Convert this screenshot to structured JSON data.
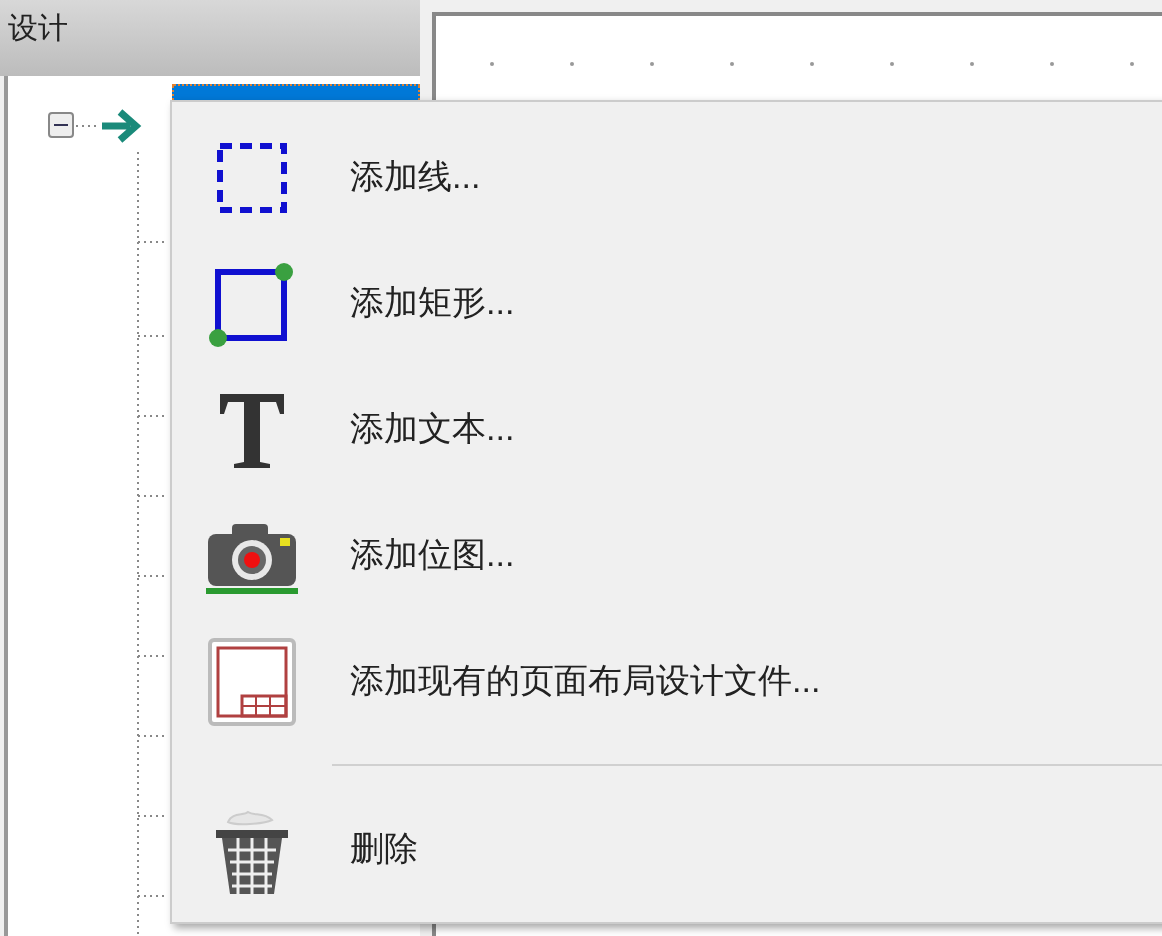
{
  "panel": {
    "title": "设计"
  },
  "tree": {
    "expanded": true
  },
  "menu": {
    "items": [
      {
        "kind": "line",
        "label": "添加线..."
      },
      {
        "kind": "rect",
        "label": "添加矩形..."
      },
      {
        "kind": "text",
        "label": "添加文本..."
      },
      {
        "kind": "bitmap",
        "label": "添加位图..."
      },
      {
        "kind": "layout",
        "label": "添加现有的页面布局设计文件..."
      },
      {
        "kind": "separator"
      },
      {
        "kind": "delete",
        "label": "删除"
      }
    ]
  }
}
